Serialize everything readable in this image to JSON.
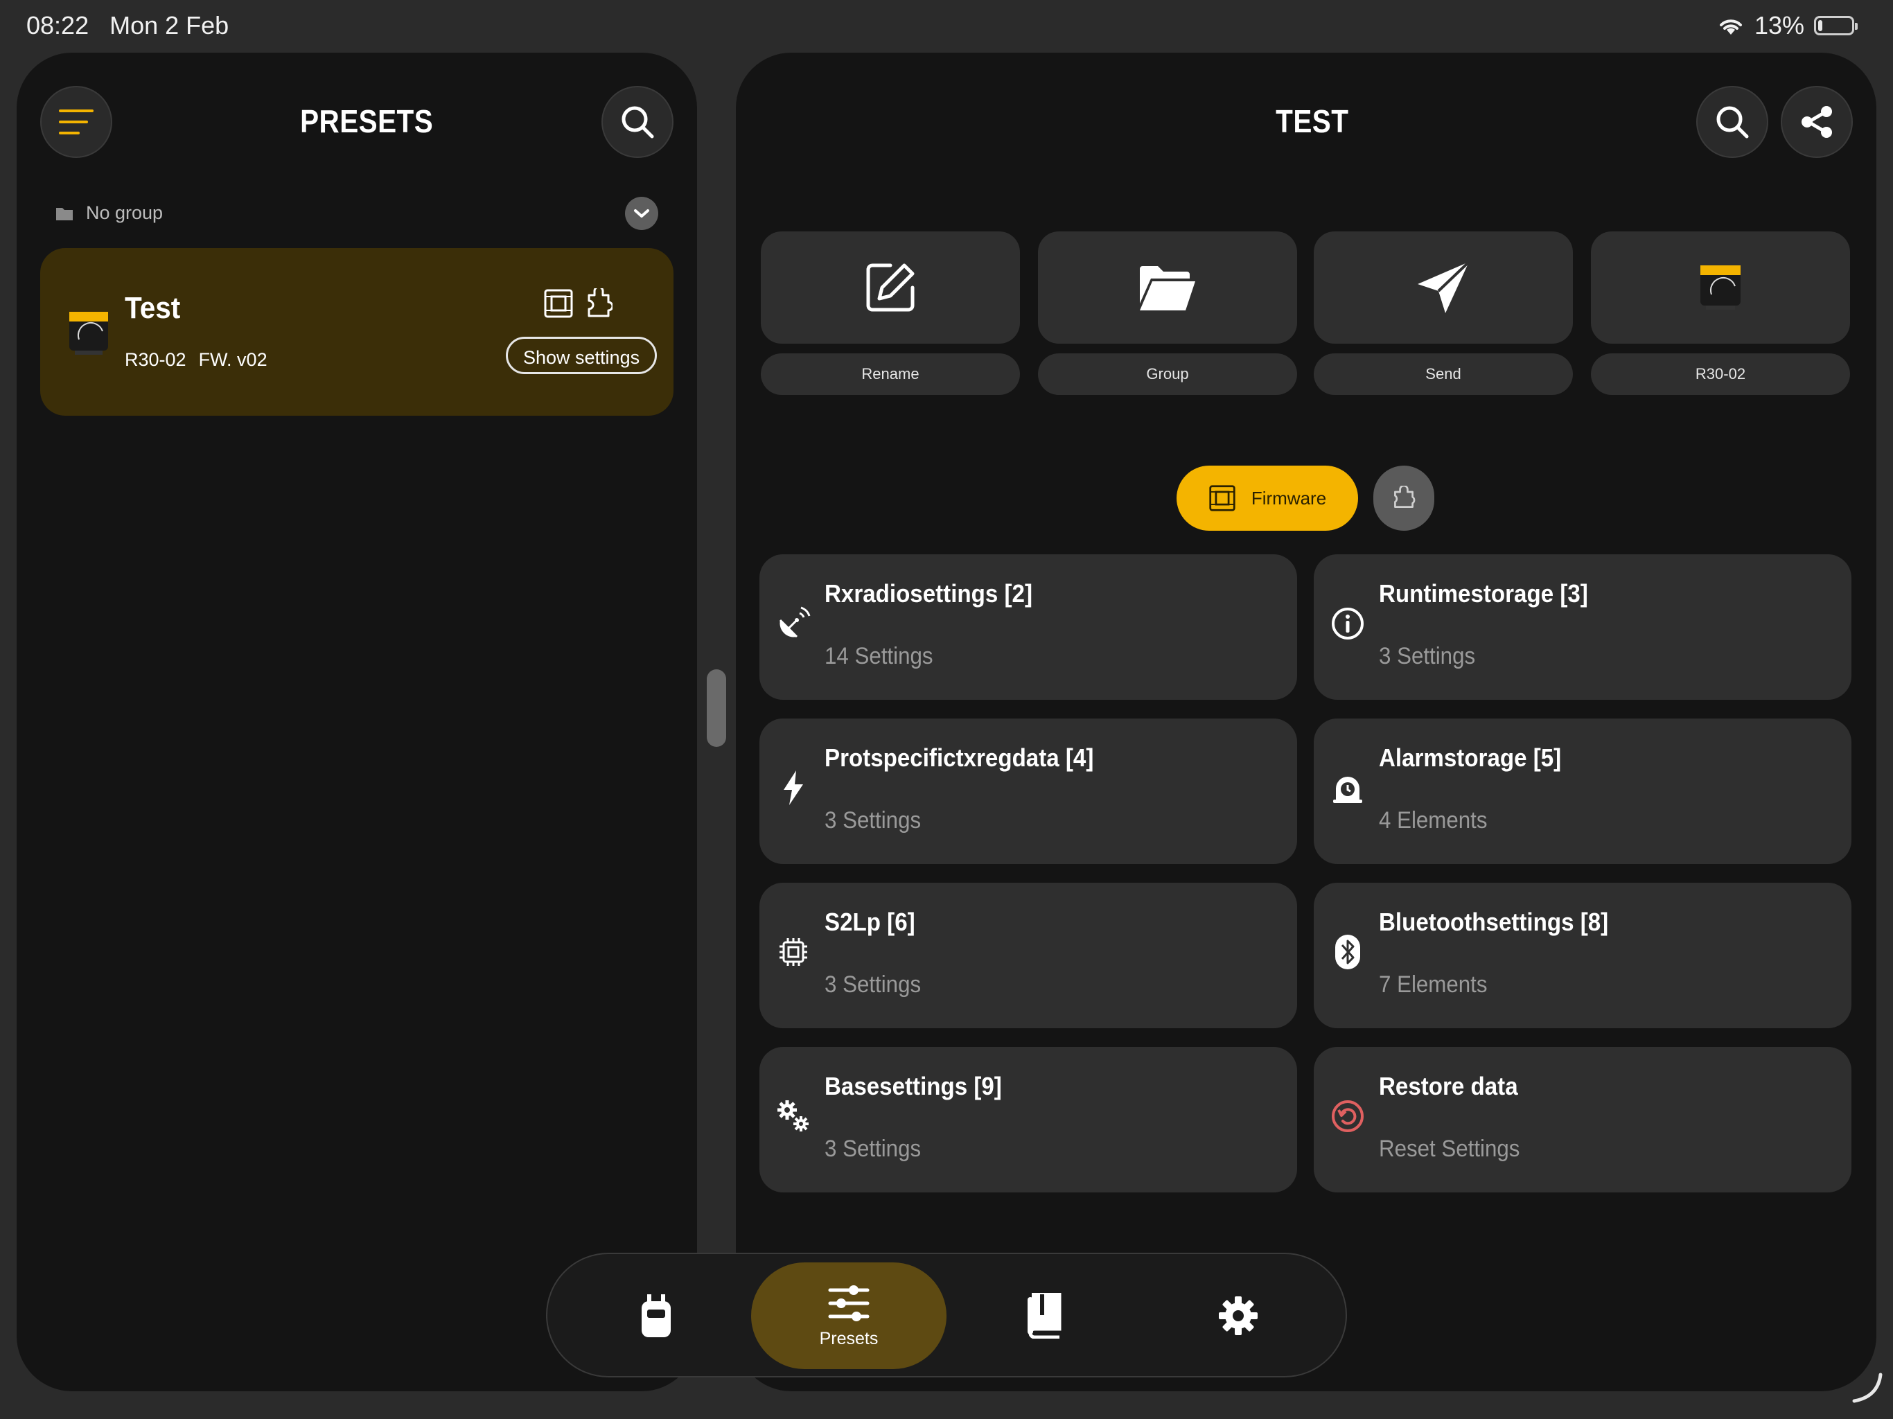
{
  "status_bar": {
    "time": "08:22",
    "date": "Mon 2 Feb",
    "battery": "13%",
    "battery_level": 0.13
  },
  "left_panel": {
    "title": "PRESETS",
    "group_label": "No group",
    "preset": {
      "name": "Test",
      "model": "R30-02",
      "firmware": "FW. v02",
      "show_settings": "Show settings"
    }
  },
  "right_panel": {
    "title": "TEST",
    "actions": [
      {
        "label": "Rename",
        "icon": "edit-icon"
      },
      {
        "label": "Group",
        "icon": "folder-icon"
      },
      {
        "label": "Send",
        "icon": "send-icon"
      },
      {
        "label": "R30-02",
        "icon": "device-thumbnail"
      }
    ],
    "filters": {
      "firmware": "Firmware"
    },
    "settings": [
      {
        "title": "Rxradiosettings [2]",
        "sub": "14 Settings",
        "icon": "satellite-dish-icon"
      },
      {
        "title": "Runtimestorage [3]",
        "sub": "3 Settings",
        "icon": "info-icon"
      },
      {
        "title": "Protspecifictxregdata [4]",
        "sub": "3 Settings",
        "icon": "lightning-icon"
      },
      {
        "title": "Alarmstorage [5]",
        "sub": "4 Elements",
        "icon": "alarm-icon"
      },
      {
        "title": "S2Lp [6]",
        "sub": "3 Settings",
        "icon": "chip-icon"
      },
      {
        "title": "Bluetoothsettings [8]",
        "sub": "7 Elements",
        "icon": "bluetooth-icon"
      },
      {
        "title": "Basesettings [9]",
        "sub": "3 Settings",
        "icon": "gears-icon"
      },
      {
        "title": "Restore data",
        "sub": "Reset Settings",
        "icon": "restore-icon"
      }
    ]
  },
  "tab_bar": {
    "tabs": [
      {
        "label": "",
        "icon": "device-icon"
      },
      {
        "label": "Presets",
        "icon": "sliders-icon"
      },
      {
        "label": "",
        "icon": "book-icon"
      },
      {
        "label": "",
        "icon": "gear-icon"
      }
    ]
  },
  "colors": {
    "accent": "#f4b400",
    "card": "#2f2f2f",
    "panel": "#141414",
    "preset_card": "#3b2e08",
    "active_tab": "#5e4a12",
    "restore": "#e06060"
  }
}
